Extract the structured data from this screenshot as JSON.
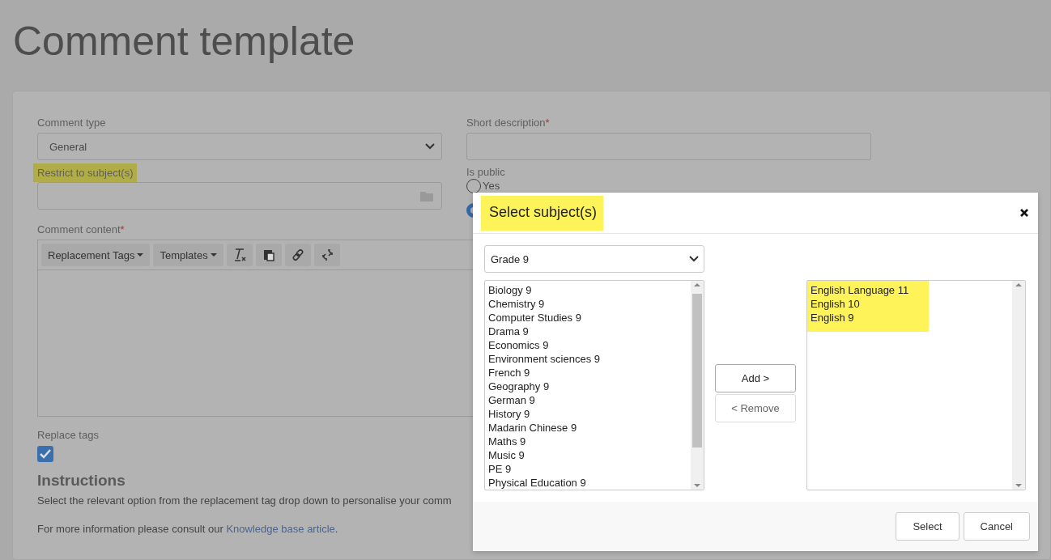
{
  "page": {
    "title": "Comment template"
  },
  "form": {
    "comment_type": {
      "label": "Comment type",
      "value": "General"
    },
    "restrict": {
      "label": "Restrict to subject(s)",
      "highlighted": true
    },
    "short_description": {
      "label": "Short description",
      "required_mark": "*"
    },
    "is_public": {
      "label": "Is public",
      "options": [
        {
          "label": "Yes",
          "selected": false
        },
        {
          "selected": true
        }
      ]
    },
    "comment_content": {
      "label": "Comment content",
      "required_mark": "*",
      "toolbar": [
        {
          "kind": "dropdown",
          "label": "Replacement Tags"
        },
        {
          "kind": "dropdown",
          "label": "Templates"
        },
        {
          "kind": "clear-format"
        },
        {
          "kind": "paste"
        },
        {
          "kind": "link"
        },
        {
          "kind": "unlink"
        }
      ]
    },
    "replace_tags": {
      "label": "Replace tags",
      "checked": true
    },
    "instructions": {
      "heading": "Instructions",
      "text": "Select the relevant option from the replacement tag drop down to personalise your comm",
      "more_text": "For more information please consult our ",
      "link": "Knowledge base article",
      "after": "."
    }
  },
  "modal": {
    "title": "Select subject(s)",
    "title_highlighted": true,
    "grade": "Grade 9",
    "available": [
      "Biology 9",
      "Chemistry 9",
      "Computer Studies 9",
      "Drama 9",
      "Economics 9",
      "Environment sciences 9",
      "French 9",
      "Geography 9",
      "German 9",
      "History 9",
      "Madarin Chinese 9",
      "Maths 9",
      "Music 9",
      "PE 9",
      "Physical Education 9"
    ],
    "selected": [
      "English Language 11",
      "English 10",
      "English 9"
    ],
    "selected_highlighted": true,
    "move_buttons": [
      {
        "label": "Add >",
        "disabled": false
      },
      {
        "label": "< Remove",
        "disabled": true
      }
    ],
    "footer_buttons": [
      "Select",
      "Cancel"
    ]
  }
}
